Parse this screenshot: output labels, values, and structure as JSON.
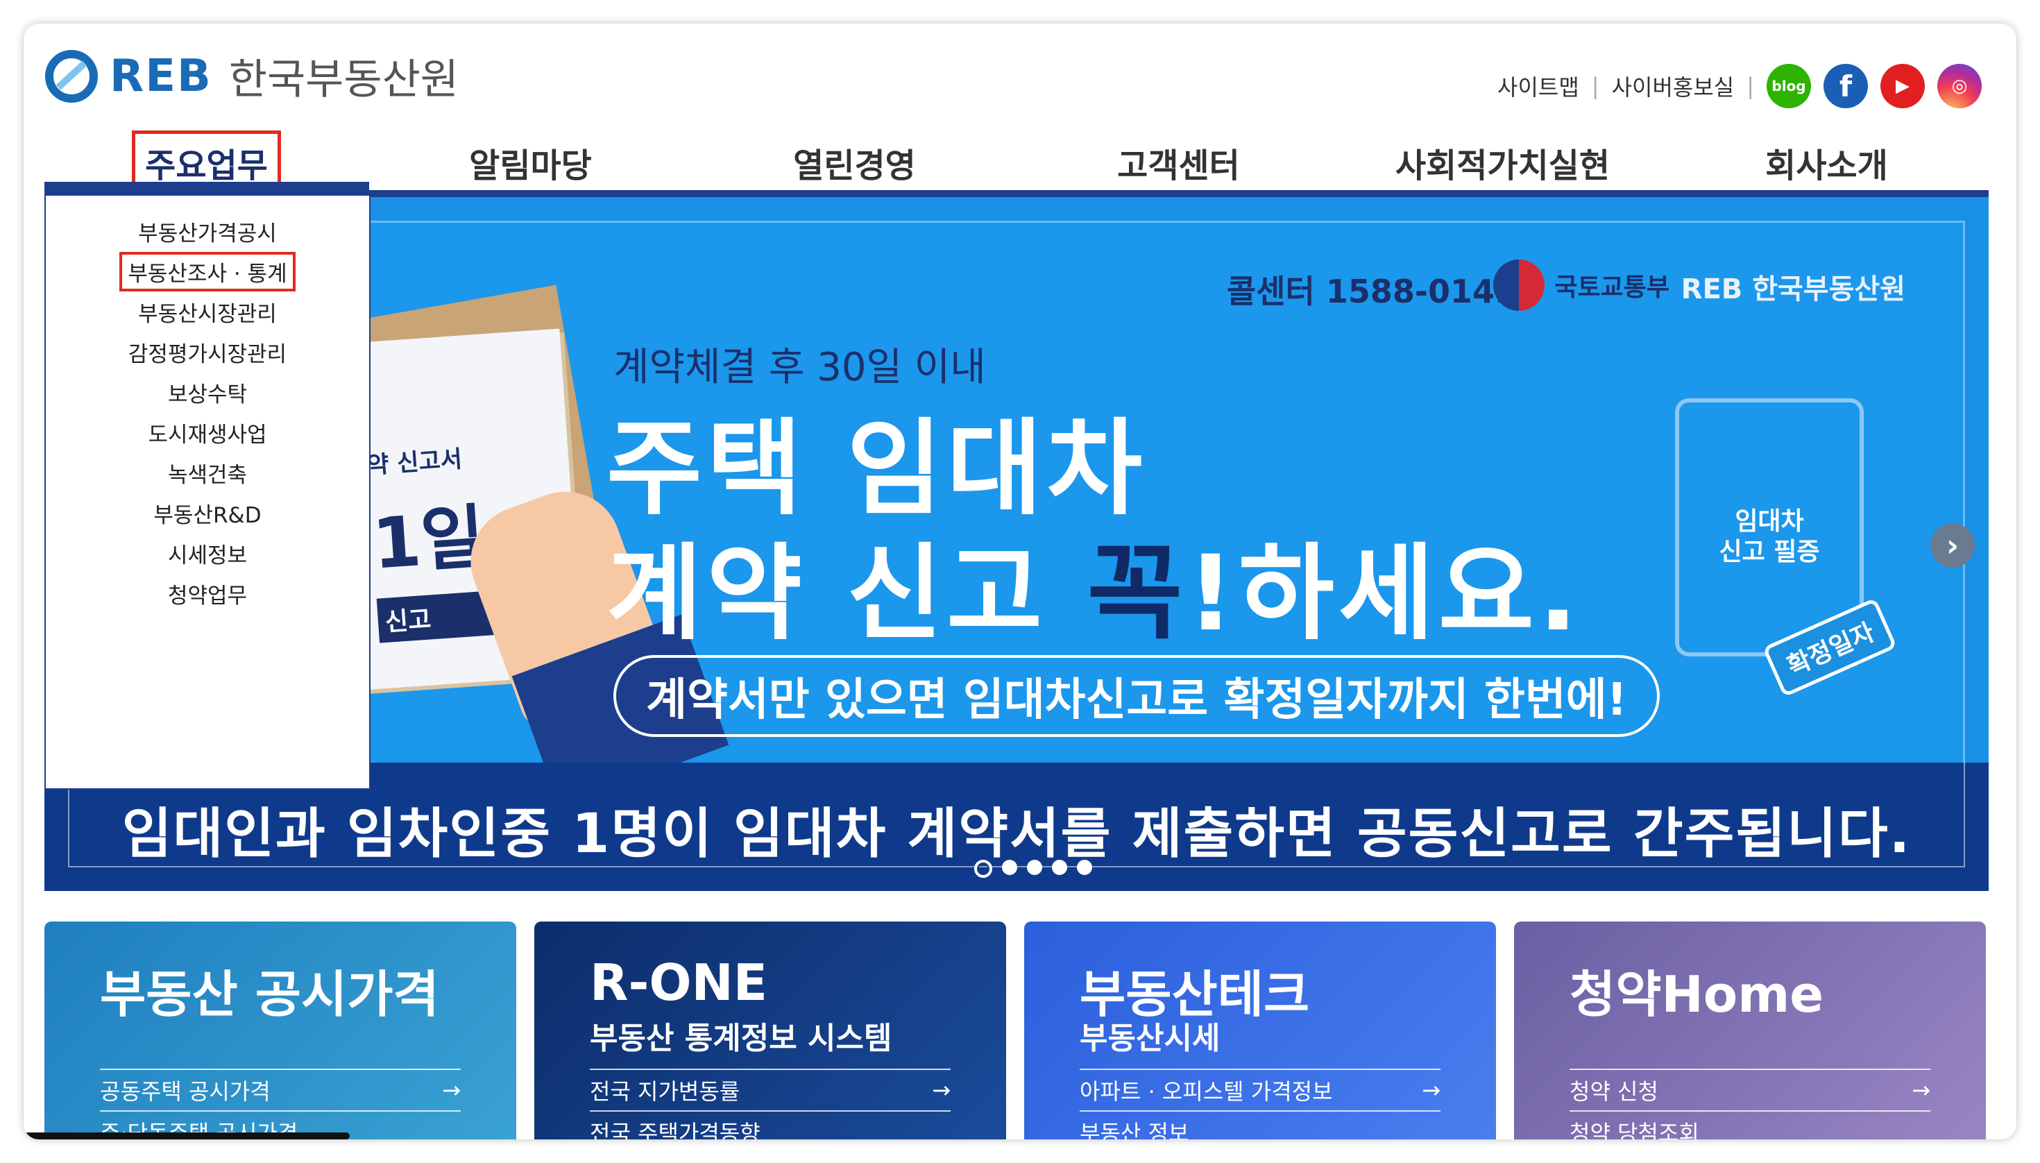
{
  "header": {
    "logo_en": "REB",
    "logo_kr": "한국부동산원",
    "util_links": [
      "사이트맵",
      "사이버홍보실"
    ],
    "sns": [
      {
        "label": "blog",
        "icon": "blog-icon",
        "color": "#2db400"
      },
      {
        "label": "f",
        "icon": "facebook-icon",
        "color": "#1a5fb5"
      },
      {
        "label": "▶",
        "icon": "youtube-icon",
        "color": "#e02020"
      },
      {
        "label": "◎",
        "icon": "instagram-icon",
        "color": "#c13584"
      }
    ]
  },
  "gnb": [
    "주요업무",
    "알림마당",
    "열린경영",
    "고객센터",
    "사회적가치실현",
    "회사소개"
  ],
  "dropdown": [
    "부동산가격공시",
    "부동산조사 · 통계",
    "부동산시장관리",
    "감정평가시장관리",
    "보상수탁",
    "도시재생사업",
    "녹색건축",
    "부동산R&D",
    "시세정보",
    "청약업무"
  ],
  "banner": {
    "callcenter": "콜센터 1588-0149",
    "molit": "국토교통부",
    "reb": "REB 한국부동산원",
    "sub": "계약체결 후 30일 이내",
    "line1": "주택 임대차",
    "line2a": "계약 신고 ",
    "line2b": "꼭",
    "line2c": "!하세요.",
    "pill": "계약서만 있으면 임대차신고로 확정일자까지 한번에!",
    "doc_t1": "약 신고서",
    "doc_t2": "1일",
    "doc_t3": "신고",
    "stamp_doc": "임대차\n신고 필증",
    "stamp": "확정일자",
    "bottom": "임대인과 임차인중 1명이 임대차 계약서를 제출하면 공동신고로 간주됩니다.",
    "next": "›",
    "slides": 5
  },
  "cards": [
    {
      "title": "부동산 공시가격",
      "sub": "",
      "links": [
        "공동주택 공시가격",
        "주·단독주택 공시가격"
      ]
    },
    {
      "title": "R-ONE",
      "sub": "부동산 통계정보 시스템",
      "links": [
        "전국 지가변동률",
        "전국 주택가격동향"
      ]
    },
    {
      "title": "부동산테크",
      "sub": "부동산시세",
      "links": [
        "아파트 · 오피스텔 가격정보",
        "부동산 정보"
      ]
    },
    {
      "title": "청약Home",
      "sub": "",
      "links": [
        "청약 신청",
        "청약 당첨조회"
      ]
    }
  ],
  "arrow": "→"
}
